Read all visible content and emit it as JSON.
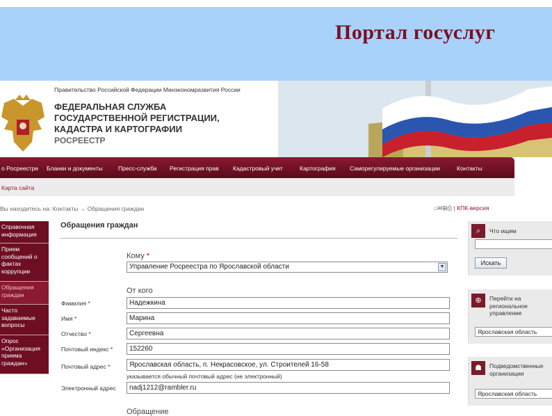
{
  "banner": {
    "title": "Портал госуслуг"
  },
  "header": {
    "gov_links": "Правительство Российской Федерации  Минэкономразвития России",
    "agency_line1": "ФЕДЕРАЛЬНАЯ СЛУЖБА",
    "agency_line2": "ГОСУДАРСТВЕННОЙ РЕГИСТРАЦИИ,",
    "agency_line3": "КАДАСТРА И КАРТОГРАФИИ",
    "agency_short": "РОСРЕЕСТР"
  },
  "topnav": [
    "о Росреестре",
    "Бланки и документы",
    "Пресс-служба",
    "Регистрация прав",
    "Кадастровый учет",
    "Картография",
    "Саморегулируемые организации",
    "Контакты"
  ],
  "submenu": {
    "label": "Карта сайта"
  },
  "breadcrumbs": "Вы находитесь на:  Контакты → Обращения граждан",
  "tools": {
    "icons": "⌂✉⊞⎙",
    "pda": "КПК-версия"
  },
  "leftnav": [
    {
      "label": "Справочная информация"
    },
    {
      "label": "Прием сообщений о фактах коррупции"
    },
    {
      "label": "Обращения граждан"
    },
    {
      "label": "Часто задаваемые вопросы"
    },
    {
      "label": "Опрос «Организация приема граждан»"
    }
  ],
  "form": {
    "title": "Обращения граждан",
    "to_section": "Кому",
    "to_value": "Управление Росреестра по Ярославской области",
    "from_section": "От кого",
    "fields": [
      {
        "label": "Фамилия",
        "value": "Надежкина"
      },
      {
        "label": "Имя",
        "value": "Марина"
      },
      {
        "label": "Отчество",
        "value": "Сергеевна"
      },
      {
        "label": "Почтовый индекс",
        "value": "152260"
      },
      {
        "label": "Почтовый адрес",
        "value": "Ярославская область, п. Некрасовское, ул. Строителей 16-58"
      },
      {
        "label": "Электронный адрес",
        "value": "nadj1212@rambler.ru"
      }
    ],
    "address_hint": "указывается обычный почтовый адрес (не электронный)",
    "appeal_section": "Обращение"
  },
  "right": {
    "search_title": "Что ищем",
    "search_button": "Искать",
    "regional_title": "Перейти на региональное управление",
    "regional_value": "Ярославская область",
    "sub_title": "Подведомственные организации",
    "sub_value": "Ярославская область"
  },
  "colors": {
    "maroon": "#6e0e22",
    "banner_blue": "#a9d2fa",
    "banner_title": "#7a1020"
  }
}
